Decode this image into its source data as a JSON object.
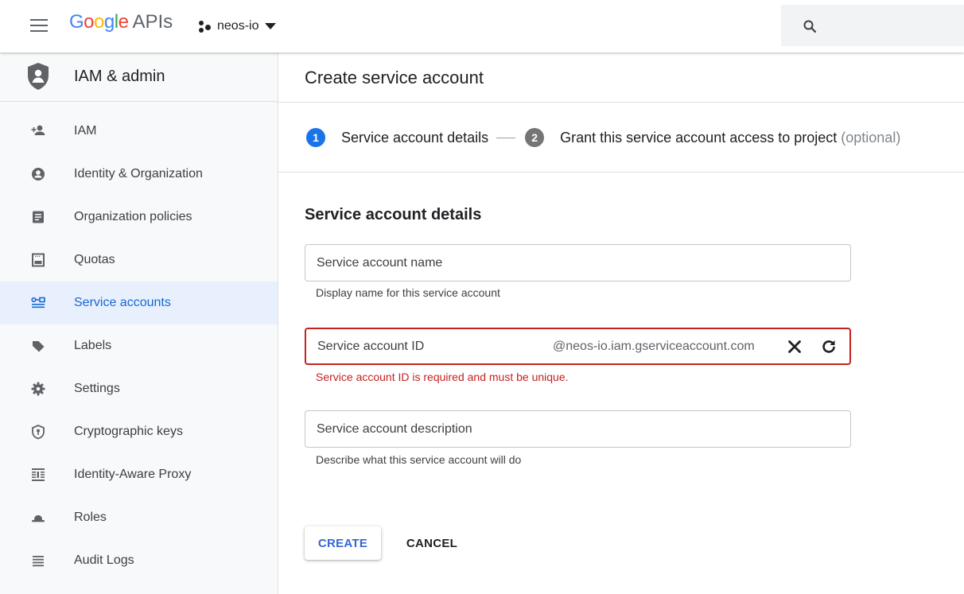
{
  "topbar": {
    "logo_google": [
      "G",
      "o",
      "o",
      "g",
      "l",
      "e"
    ],
    "logo_apis": "APIs",
    "project_name": "neos-io",
    "menu_icon": "hamburger-menu-icon",
    "project_icon": "project-dots-icon",
    "dropdown_icon": "caret-down-icon",
    "search_icon": "search-icon"
  },
  "sidebar": {
    "title": "IAM & admin",
    "header_icon": "shield-icon",
    "items": [
      {
        "label": "IAM",
        "icon": "person-add-icon"
      },
      {
        "label": "Identity & Organization",
        "icon": "account-circle-icon"
      },
      {
        "label": "Organization policies",
        "icon": "document-icon"
      },
      {
        "label": "Quotas",
        "icon": "quota-icon"
      },
      {
        "label": "Service accounts",
        "icon": "service-account-icon"
      },
      {
        "label": "Labels",
        "icon": "label-icon"
      },
      {
        "label": "Settings",
        "icon": "gear-icon"
      },
      {
        "label": "Cryptographic keys",
        "icon": "security-key-icon"
      },
      {
        "label": "Identity-Aware Proxy",
        "icon": "proxy-icon"
      },
      {
        "label": "Roles",
        "icon": "hat-icon"
      },
      {
        "label": "Audit Logs",
        "icon": "list-icon"
      }
    ],
    "active_index": 4
  },
  "main": {
    "page_title": "Create service account",
    "stepper": {
      "step1_number": "1",
      "step1_label": "Service account details",
      "step2_number": "2",
      "step2_label": "Grant this service account access to project",
      "step2_optional": "(optional)"
    },
    "section_title": "Service account details",
    "fields": {
      "name": {
        "placeholder": "Service account name",
        "value": "",
        "hint": "Display name for this service account"
      },
      "id": {
        "placeholder": "Service account ID",
        "value": "",
        "suffix": "@neos-io.iam.gserviceaccount.com",
        "error": "Service account ID is required and must be unique."
      },
      "description": {
        "placeholder": "Service account description",
        "value": "",
        "hint": "Describe what this service account will do"
      }
    },
    "buttons": {
      "create": "CREATE",
      "cancel": "CANCEL"
    }
  },
  "colors": {
    "primary_blue": "#1a73e8",
    "active_nav_bg": "#e8f0fe",
    "active_nav_text": "#1967d2",
    "error_red": "#c5221f",
    "button_blue": "#3367d6"
  }
}
